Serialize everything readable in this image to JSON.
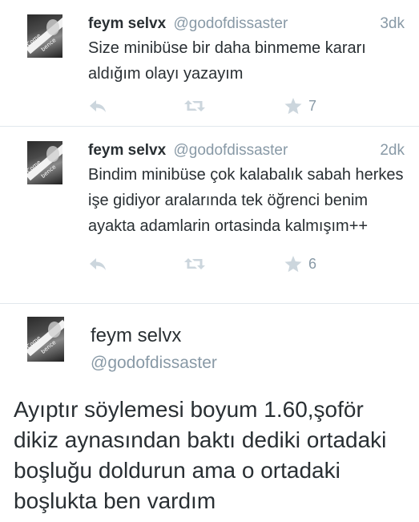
{
  "tweets": [
    {
      "name": "feym selvx",
      "handle": "@godofdissaster",
      "time": "3dk",
      "text": "Size minibüse bir daha binmeme kararı aldığım olayı yazayım",
      "favorites": "7"
    },
    {
      "name": "feym selvx",
      "handle": "@godofdissaster",
      "time": "2dk",
      "text": "Bindim minibüse çok kalabalık sabah herkes işe gidiyor aralarında tek öğrenci benim ayakta adamlarin ortasinda kalmışım++",
      "favorites": "6"
    }
  ],
  "main_tweet": {
    "name": "feym selvx",
    "handle": "@godofdissaster",
    "text": "Ayıptır söylemesi boyum 1.60,şoför dikiz aynasından baktı dediki ortadaki boşluğu doldurun ama o ortadaki boşlukta ben vardım"
  },
  "avatar_text": {
    "line1": "Come",
    "line2": "bence"
  },
  "colors": {
    "text": "#292f33",
    "secondary": "#8899a6",
    "icon": "#ccd6dd",
    "divider": "#e1e8ed"
  }
}
